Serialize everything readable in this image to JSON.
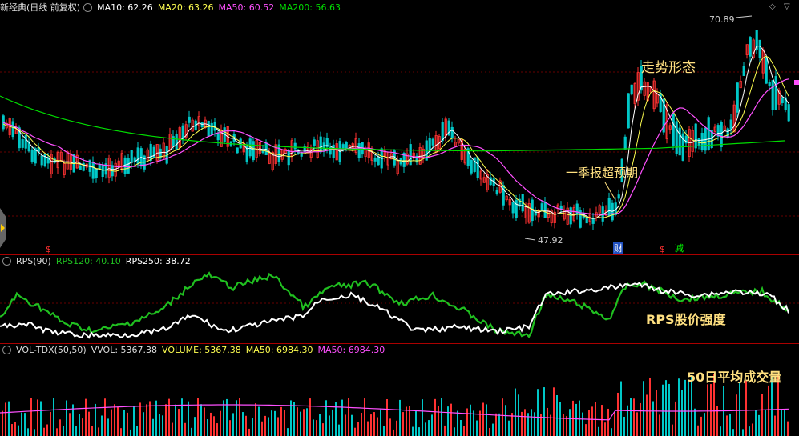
{
  "main_header": {
    "stock_name": "新经典(日线 前复权)",
    "ma10": "MA10: 62.26",
    "ma20": "MA20: 63.26",
    "ma50": "MA50: 60.52",
    "ma200": "MA200: 56.63"
  },
  "rps_header": {
    "title": "RPS(90)",
    "rps120": "RPS120: 40.10",
    "rps250": "RPS250: 38.72"
  },
  "vol_header": {
    "title": "VOL-TDX(50,50)",
    "vvol": "VVOL: 5367.38",
    "volume": "VOLUME: 5367.38",
    "ma50a": "MA50: 6984.30",
    "ma50b": "MA50: 6984.30"
  },
  "annotations": {
    "trend": "走势形态",
    "q1": "一季报超预期",
    "rps_strength": "RPS股价强度",
    "avg_volume": "50日平均成交量",
    "high": "70.89",
    "low": "47.92",
    "cai": "财",
    "jian": "减"
  },
  "colors": {
    "up": "#ff3232",
    "down": "#00c8c8",
    "ma10": "#ffffff",
    "ma20": "#ffff50",
    "ma50": "#ff50ff",
    "ma200": "#00dc00",
    "rps120": "#20c020",
    "rps250": "#ffffff",
    "annotation": "#ffe080"
  },
  "icons": [
    "chevron-up-icon",
    "chevron-down-icon",
    "panel-toggle-icon",
    "scroll-left-handle"
  ]
}
